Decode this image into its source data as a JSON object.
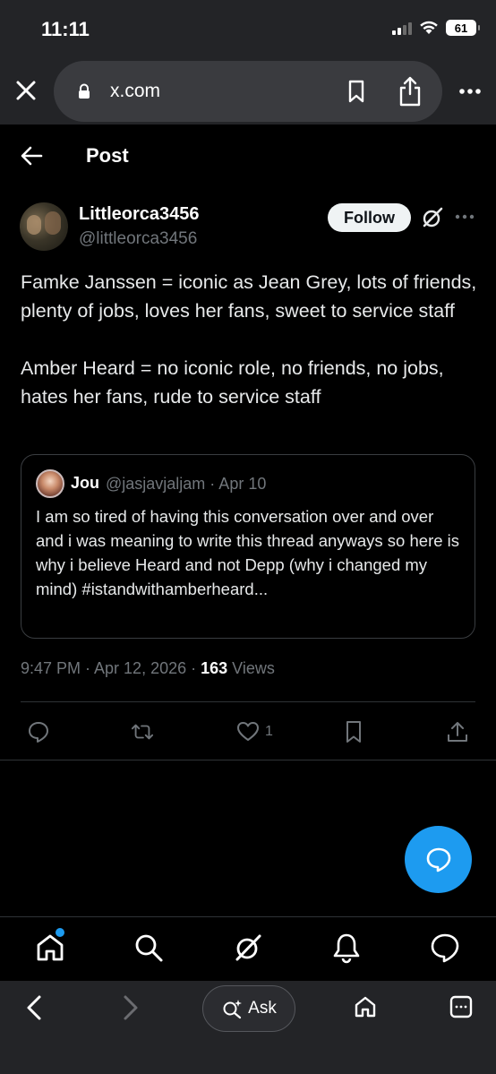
{
  "status_bar": {
    "time": "11:11",
    "battery": "61"
  },
  "browser": {
    "url": "x.com"
  },
  "header": {
    "title": "Post"
  },
  "post": {
    "display_name": "Littleorca3456",
    "handle": "@littleorca3456",
    "follow_label": "Follow",
    "paragraphs": [
      "Famke Janssen = iconic as Jean Grey, lots of friends, plenty of jobs, loves her fans, sweet to service staff",
      "Amber Heard = no iconic role, no friends, no jobs, hates her fans, rude to service staff"
    ],
    "quote": {
      "name": "Jou",
      "meta": "@jasjavjaljam · Apr 10",
      "text": "I am so tired of having this conversation over and over and i was meaning to write this thread anyways so here is why i believe Heard and not Depp (why i changed my mind) #istandwithamberheard..."
    },
    "timestamp": "9:47 PM · Apr 12, 2026 · ",
    "views_count": "163",
    "views_label": " Views",
    "like_count": "1"
  },
  "safari": {
    "ask_label": "Ask"
  },
  "colors": {
    "accent": "#1d9bf0",
    "background": "#000000",
    "chrome": "#232427",
    "muted": "#71767b"
  },
  "icons": [
    "close-icon",
    "lock-icon",
    "bookmark-icon",
    "share-icon",
    "more-icon",
    "back-arrow-icon",
    "grok-icon",
    "reply-icon",
    "repost-icon",
    "like-icon",
    "bookmark-icon",
    "share-icon",
    "compose-message-icon",
    "home-icon",
    "search-icon",
    "grok-icon",
    "notifications-icon",
    "messages-icon",
    "chevron-left-icon",
    "chevron-right-icon",
    "ask-sparkle-icon",
    "tabs-icon"
  ]
}
